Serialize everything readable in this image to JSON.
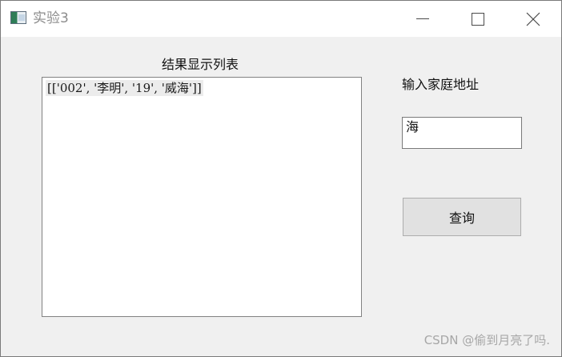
{
  "window": {
    "title": "实验3",
    "app_icon": "app-window-icon",
    "controls": {
      "minimize_icon": "minimize-icon",
      "maximize_icon": "maximize-icon",
      "close_icon": "close-icon"
    }
  },
  "results": {
    "label": "结果显示列表",
    "items": [
      "[['002', '李明', '19', '威海']]"
    ]
  },
  "address": {
    "label": "输入家庭地址",
    "value": "海"
  },
  "query_button": {
    "label": "查询"
  },
  "watermark": {
    "text": "CSDN @偷到月亮了吗."
  },
  "colors": {
    "window_bg": "#f0f0f0",
    "titlebar_bg": "#ffffff",
    "button_bg": "#e1e1e1",
    "watermark": "#a7a7a7"
  }
}
